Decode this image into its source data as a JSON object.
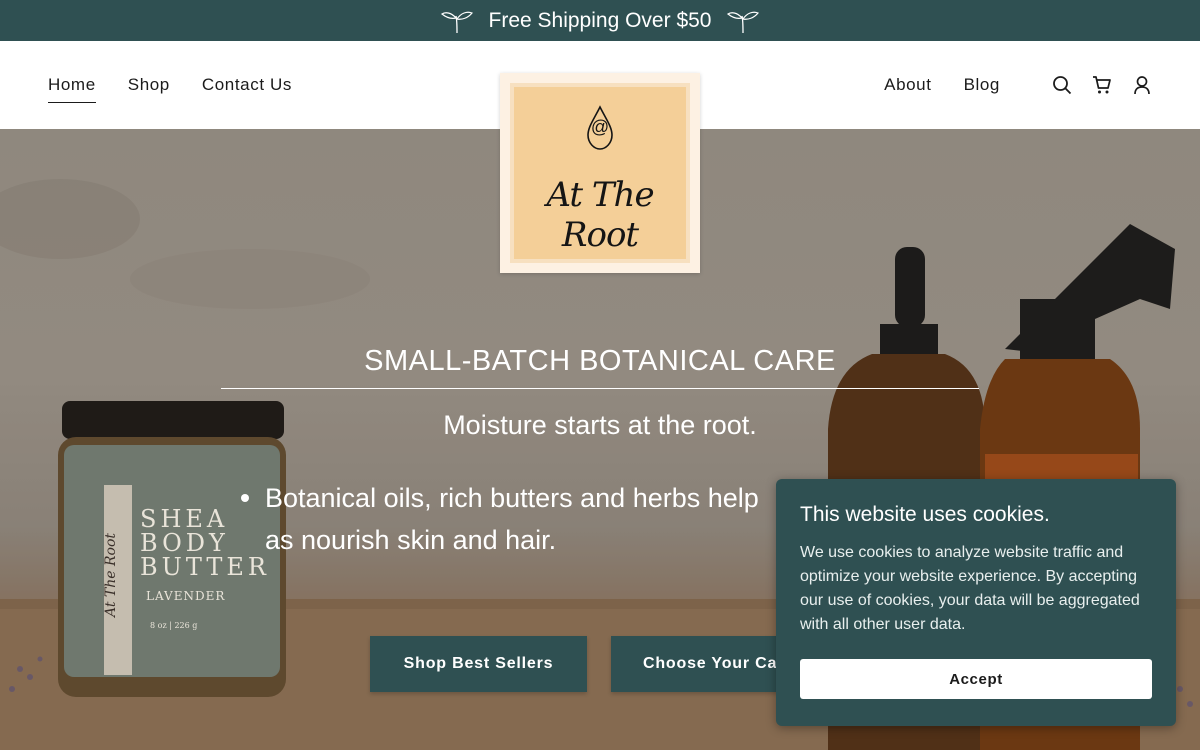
{
  "announcement": {
    "text": "Free Shipping Over $50",
    "icon": "sprout-icon"
  },
  "nav": {
    "left": [
      {
        "label": "Home",
        "active": true
      },
      {
        "label": "Shop"
      },
      {
        "label": "Contact Us"
      }
    ],
    "right": [
      {
        "label": "About"
      },
      {
        "label": "Blog"
      }
    ],
    "icons": [
      "search-icon",
      "cart-icon",
      "account-icon"
    ]
  },
  "logo": {
    "text": "At The Root",
    "mark": "@"
  },
  "hero": {
    "title": "SMALL-BATCH BOTANICAL CARE",
    "subtitle": "Moisture starts at the root.",
    "bullets": [
      "Botanical oils, rich butters and herbs help",
      "as nourish skin and hair."
    ],
    "buttons": {
      "primary": "Shop Best Sellers",
      "secondary": "Choose Your Ca"
    },
    "jar_label": {
      "brand": "At The Root",
      "line1": "SHEA",
      "line2": "BODY",
      "line3": "BUTTER",
      "variant": "LAVENDER",
      "size": "8 oz | 226 g"
    }
  },
  "cookie": {
    "title": "This website uses cookies.",
    "body": "We use cookies to analyze website traffic and optimize your website experience. By accepting our use of cookies, your data will be aggregated with all other user data.",
    "accept": "Accept"
  },
  "colors": {
    "brand": "#2f5052",
    "logo_bg": "#f4cf98"
  }
}
